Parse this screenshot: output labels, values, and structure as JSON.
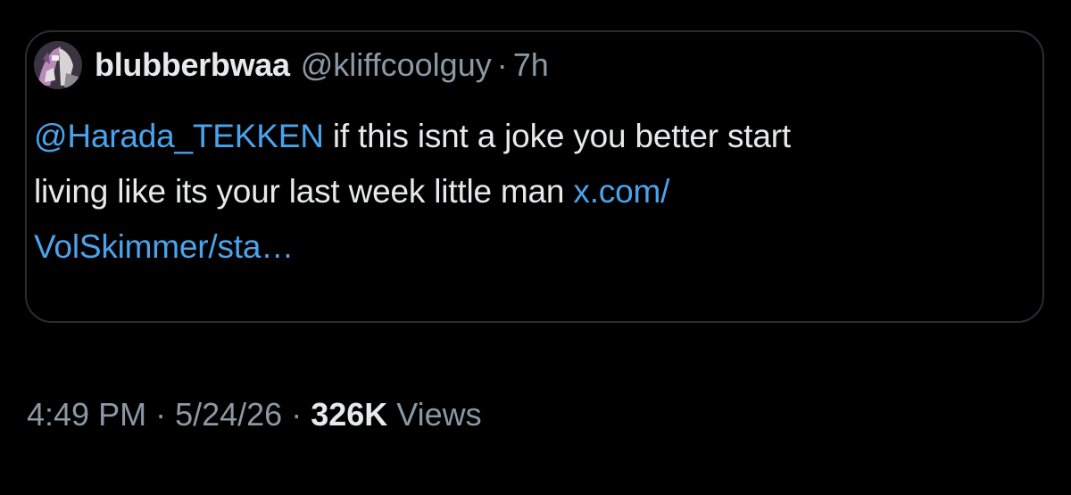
{
  "quoted_tweet": {
    "author": {
      "display_name": "blubberbwaa",
      "handle": "@kliffcoolguy",
      "avatar_icon": "user-avatar"
    },
    "separator": "·",
    "time_ago": "7h",
    "mention": "@Harada_TEKKEN",
    "text_line1": " if this isnt a joke you better start",
    "text_line2": "living like its your last week little man ",
    "link_part1": "x.com/",
    "link_part2": "VolSkimmer/sta…"
  },
  "tweet_meta": {
    "time": "4:49 PM",
    "dot": "·",
    "date": "5/24/26",
    "views_count": "326K",
    "views_label": "Views"
  },
  "colors": {
    "background": "#000000",
    "text": "#e7e9ea",
    "muted": "#8b98a5",
    "link": "#4ba3ec",
    "card_border": "#2a2d31"
  }
}
